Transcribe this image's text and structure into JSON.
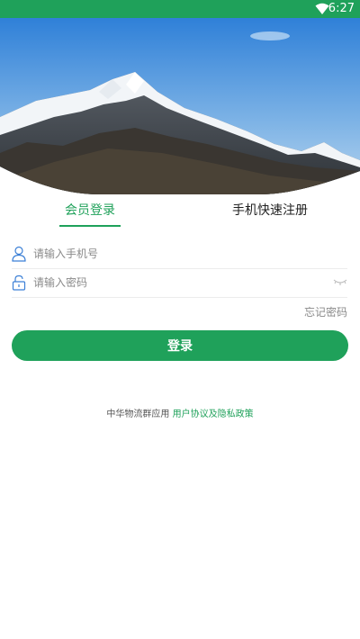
{
  "status_bar": {
    "time": "6:27"
  },
  "tabs": {
    "member_login": "会员登录",
    "quick_register": "手机快速注册"
  },
  "form": {
    "phone_placeholder": "请输入手机号",
    "password_placeholder": "请输入密码",
    "forgot_password": "忘记密码",
    "login_button": "登录"
  },
  "footer": {
    "app_text": "中华物流群应用",
    "policy_link": "用户协议及隐私政策"
  },
  "icons": {
    "wifi": "wifi-icon",
    "user": "user-icon",
    "lock": "lock-icon",
    "eye": "eye-closed-icon"
  },
  "colors": {
    "accent": "#1fa15a",
    "text": "#222222",
    "placeholder": "#8a8a8a"
  }
}
